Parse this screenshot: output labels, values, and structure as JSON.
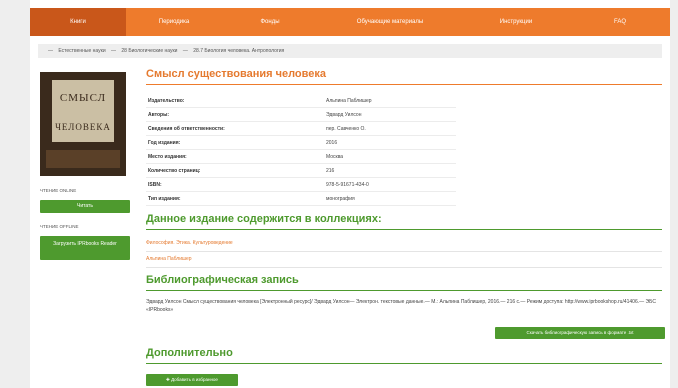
{
  "nav": {
    "items": [
      "Книги",
      "Периодика",
      "Фонды",
      "Обучающие материалы",
      "Инструкции",
      "FAQ"
    ]
  },
  "breadcrumb": [
    "—",
    "Естественные науки",
    "—",
    "28 Биологические науки",
    "—",
    "28.7 Биология человека. Антропология"
  ],
  "cover": {
    "line1": "СМЫСЛ",
    "line2": "ЧЕЛОВЕКА"
  },
  "sidebar": {
    "online_label": "ЧТЕНИЕ ONLINE",
    "read_button": "Читать",
    "offline_label": "ЧТЕНИЕ OFFLINE",
    "download_button": "Загрузить IPRbooks Reader"
  },
  "book": {
    "title": "Смысл существования человека",
    "fields": [
      {
        "label": "Издательство:",
        "value": "Альпина Паблишер"
      },
      {
        "label": "Авторы:",
        "value": "Эдвард Уилсон"
      },
      {
        "label": "Сведения об ответственности:",
        "value": "пер. Савченко О."
      },
      {
        "label": "Год издания:",
        "value": "2016"
      },
      {
        "label": "Место издания:",
        "value": "Москва"
      },
      {
        "label": "Количество страниц:",
        "value": "216"
      },
      {
        "label": "ISBN:",
        "value": "978-5-91671-434-0"
      },
      {
        "label": "Тип издания:",
        "value": "монография"
      }
    ]
  },
  "collections": {
    "heading": "Данное издание содержится в коллекциях:",
    "items": [
      "Философия. Этика. Культуроведение",
      "Альпина Паблишер"
    ]
  },
  "biblio": {
    "heading": "Библиографическая запись",
    "text": "Эдвард Уилсон Смысл существования человека [Электронный ресурс]/ Эдвард Уилсон— Электрон. текстовые данные.— М.: Альпина Паблишер, 2016.— 216 c.— Режим доступа: http://www.iprbookshop.ru/41406.— ЭБС «IPRbooks»",
    "download_button": "Скачать библиографическую запись в формате .txt"
  },
  "extra": {
    "heading": "Дополнительно",
    "favorite_button": "✚ Добавить в избранное"
  },
  "colors": {
    "accent": "#ee7b2c",
    "green": "#4e9a2e"
  }
}
